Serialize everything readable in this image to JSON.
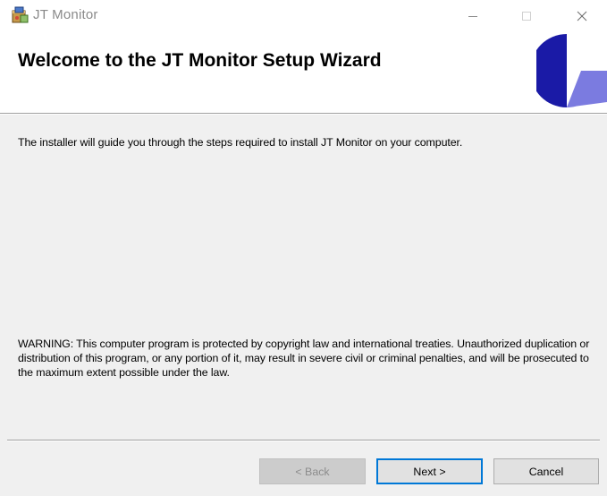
{
  "window": {
    "title": "JT Monitor",
    "icon": "installer-package-icon",
    "controls": [
      "minimize-icon",
      "maximize-icon",
      "close-icon"
    ]
  },
  "header": {
    "title": "Welcome to the JT Monitor Setup Wizard",
    "logo": "setup-logo-icon"
  },
  "body": {
    "intro": "The installer will guide you through the steps required to install JT Monitor on your computer.",
    "warning": "WARNING: This computer program is protected by copyright law and international treaties. Unauthorized duplication or distribution of this program, or any portion of it, may result in severe civil or criminal penalties, and will be prosecuted to the maximum extent possible under the law."
  },
  "buttons": {
    "back": "< Back",
    "next": "Next >",
    "cancel": "Cancel"
  },
  "colors": {
    "logo_dark": "#1a1aa6",
    "logo_light": "#7b7be0",
    "focus_border": "#0078d7"
  }
}
